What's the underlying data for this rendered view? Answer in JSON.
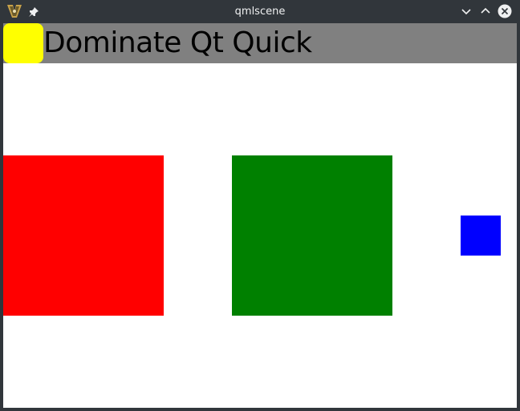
{
  "window": {
    "title": "qmlscene",
    "icons": {
      "app": "kde-app-icon",
      "pin": "pin-icon",
      "minimize": "chevron-down-icon",
      "maximize": "chevron-up-icon",
      "close": "close-circle-icon"
    }
  },
  "scene": {
    "header": {
      "text": "Dominate Qt Quick",
      "bar_color": "#808080",
      "badge_color": "#ffff00"
    },
    "squares": [
      {
        "name": "red",
        "color": "#ff0000"
      },
      {
        "name": "green",
        "color": "#008000"
      },
      {
        "name": "blue",
        "color": "#0000ff"
      }
    ]
  }
}
